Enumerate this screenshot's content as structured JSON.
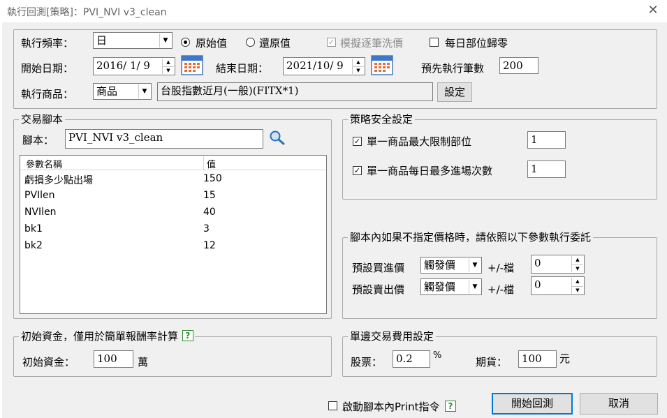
{
  "window": {
    "title": "執行回測[策略]：PVI_NVI v3_clean",
    "close_glyph": "✕"
  },
  "settings": {
    "freq_label": "執行頻率：",
    "freq_value": "日",
    "radio_original": "原始值",
    "radio_restored": "還原值",
    "simulate_label": "模擬逐筆洗價",
    "daily_reset_label": "每日部位歸零",
    "start_label": "開始日期：",
    "start_value": "2016/ 1/ 9",
    "end_label": "結束日期：",
    "end_value": "2021/10/ 9",
    "prebars_label": "預先執行筆數",
    "prebars_value": "200",
    "product_label": "執行商品：",
    "product_type": "商品",
    "product_value": "台股指數近月(一般)(FITX*1)",
    "setup_button": "設定"
  },
  "script": {
    "legend": "交易腳本",
    "script_label": "腳本：",
    "script_value": "PVI_NVI v3_clean",
    "col_name": "參數名稱",
    "col_value": "值",
    "params": [
      {
        "name": "虧損多少點出場",
        "value": "150"
      },
      {
        "name": "PVIlen",
        "value": "15"
      },
      {
        "name": "NVIlen",
        "value": "40"
      },
      {
        "name": "bk1",
        "value": "3"
      },
      {
        "name": "bk2",
        "value": "12"
      }
    ]
  },
  "safety": {
    "legend": "策略安全設定",
    "max_position_label": "單一商品最大限制部位",
    "max_position_value": "1",
    "max_entries_label": "單一商品每日最多進場次數",
    "max_entries_value": "1"
  },
  "price": {
    "legend": "腳本內如果不指定價格時，請依照以下參數執行委託",
    "buy_label": "預設買進價",
    "buy_value": "觸發價",
    "sell_label": "預設賣出價",
    "sell_value": "觸發價",
    "tick_label": "+/-檔",
    "buy_tick": "0",
    "sell_tick": "0"
  },
  "capital": {
    "legend": "初始資金，僅用於簡單報酬率計算",
    "label": "初始資金：",
    "value": "100",
    "unit": "萬"
  },
  "fees": {
    "legend": "單邊交易費用設定",
    "stock_label": "股票：",
    "stock_value": "0.2",
    "stock_unit": "%",
    "futures_label": "期貨：",
    "futures_value": "100",
    "futures_unit": "元"
  },
  "footer": {
    "print_label": "啟動腳本內Print指令",
    "start_button": "開始回測",
    "cancel_button": "取消"
  },
  "icons": {
    "help": "?",
    "check": "✓",
    "arrow_down": "▼",
    "arrow_up": "▲",
    "magnifier": "search-icon",
    "calendar": "calendar-icon"
  }
}
